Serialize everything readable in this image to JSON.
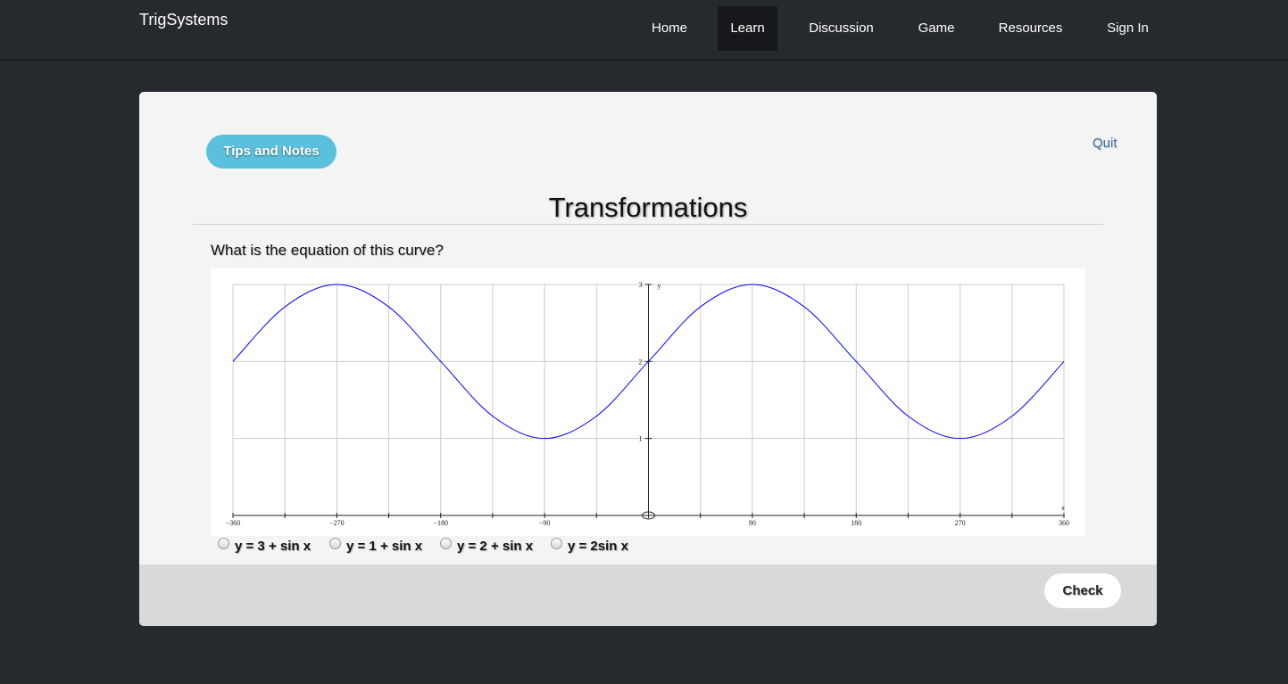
{
  "navbar": {
    "brand": "TrigSystems",
    "items": [
      {
        "label": "Home",
        "active": false
      },
      {
        "label": "Learn",
        "active": true
      },
      {
        "label": "Discussion",
        "active": false
      },
      {
        "label": "Game",
        "active": false
      },
      {
        "label": "Resources",
        "active": false
      },
      {
        "label": "Sign In",
        "active": false
      }
    ]
  },
  "exercise": {
    "tips_label": "Tips and Notes",
    "quit_label": "Quit",
    "title": "Transformations",
    "question": "What is the equation of this curve?",
    "options": [
      "y = 3 + sin x",
      "y = 1 + sin x",
      "y = 2 + sin x",
      "y = 2sin x"
    ],
    "check_label": "Check"
  },
  "colors": {
    "accent": "#5bc0de",
    "curve": "#0000ff",
    "background": "#26292e"
  },
  "chart_data": {
    "type": "line",
    "title": "",
    "xlabel": "x",
    "ylabel": "y",
    "xlim": [
      -360,
      360
    ],
    "ylim": [
      0,
      3
    ],
    "x_ticks": [
      "−360",
      "−270",
      "−180",
      "−90",
      "90",
      "180",
      "270",
      "360"
    ],
    "y_ticks": [
      "1",
      "2",
      "3"
    ],
    "grid": true,
    "series": [
      {
        "values_x": [
          -360,
          -315,
          -270,
          -225,
          -180,
          -135,
          -90,
          -45,
          0,
          45,
          90,
          135,
          180,
          225,
          270,
          315,
          360
        ],
        "values_y": [
          2,
          2.71,
          3,
          2.71,
          2,
          1.29,
          1,
          1.29,
          2,
          2.71,
          3,
          2.71,
          2,
          1.29,
          1,
          1.29,
          2
        ]
      }
    ]
  }
}
